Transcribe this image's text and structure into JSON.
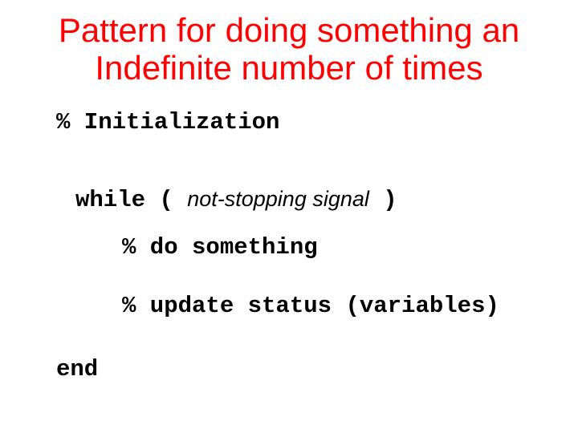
{
  "title_line1": "Pattern for doing something an",
  "title_line2": "Indefinite number of times",
  "code": {
    "init": "% Initialization",
    "while_kw": "while",
    "paren_open": " ( ",
    "condition": "not-stopping signal",
    "paren_close": " )",
    "do_something": "% do something",
    "update": "% update status (variables)",
    "end_kw": "end"
  }
}
